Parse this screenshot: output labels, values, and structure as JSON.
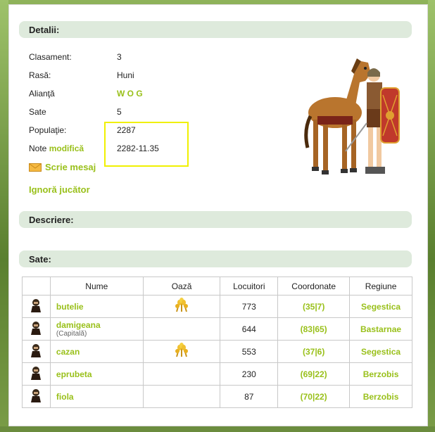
{
  "sections": {
    "details_title": "Detalii:",
    "description_title": "Descriere:",
    "villages_title": "Sate:"
  },
  "details": {
    "rank_label": "Clasament:",
    "rank_value": "3",
    "race_label": "Rasă:",
    "race_value": "Huni",
    "alliance_label": "Alianţă",
    "alliance_value": "W O G",
    "villages_label": "Sate",
    "villages_value": "5",
    "population_label": "Populaţie:",
    "population_value": "2287",
    "note_label": "Note",
    "note_edit_link": "modifică",
    "note_value": "2282-11.35"
  },
  "actions": {
    "write_message": "Scrie mesaj",
    "ignore_player": "Ignoră jucător"
  },
  "table": {
    "headers": {
      "name": "Nume",
      "oasis": "Oază",
      "inhabitants": "Locuitori",
      "coords": "Coordonate",
      "region": "Regiune"
    },
    "rows": [
      {
        "name": "butelie",
        "capital": "",
        "oasis": true,
        "inhabitants": "773",
        "coords": "(35|7)",
        "region": "Segestica"
      },
      {
        "name": "damigeana",
        "capital": "(Capitală)",
        "oasis": false,
        "inhabitants": "644",
        "coords": "(83|65)",
        "region": "Bastarnae"
      },
      {
        "name": "cazan",
        "capital": "",
        "oasis": true,
        "inhabitants": "553",
        "coords": "(37|6)",
        "region": "Segestica"
      },
      {
        "name": "eprubeta",
        "capital": "",
        "oasis": false,
        "inhabitants": "230",
        "coords": "(69|22)",
        "region": "Berzobis"
      },
      {
        "name": "fiola",
        "capital": "",
        "oasis": false,
        "inhabitants": "87",
        "coords": "(70|22)",
        "region": "Berzobis"
      }
    ]
  },
  "colors": {
    "accent_green": "#99c01a",
    "section_bg": "#deeadc",
    "highlight": "#f0f000"
  },
  "icons": {
    "tribe": "hun-warrior-icon",
    "oasis": "wheat-oasis-icon",
    "message": "envelope-icon"
  }
}
